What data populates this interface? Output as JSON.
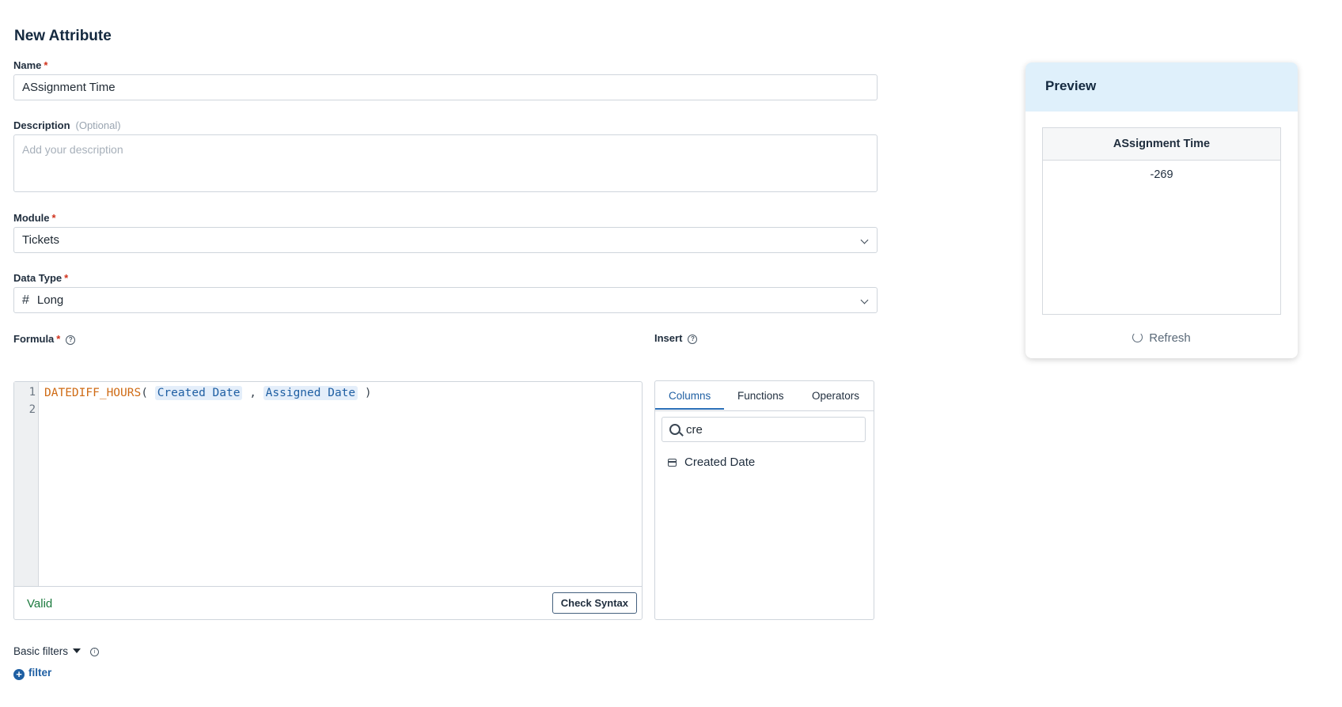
{
  "page": {
    "title": "New Attribute"
  },
  "name": {
    "label": "Name",
    "required": "*",
    "value": "ASsignment Time"
  },
  "description": {
    "label": "Description",
    "optional": "(Optional)",
    "placeholder": "Add your description"
  },
  "module": {
    "label": "Module",
    "required": "*",
    "value": "Tickets"
  },
  "data_type": {
    "label": "Data Type",
    "required": "*",
    "icon": "hash-icon",
    "icon_glyph": "#",
    "value": "Long"
  },
  "formula": {
    "label": "Formula",
    "required": "*",
    "line_numbers": [
      "1",
      "2"
    ],
    "function": "DATEDIFF_HOURS",
    "open_paren": "(",
    "arg1": "Created Date",
    "comma": ",",
    "arg2": "Assigned Date",
    "close_paren": ")",
    "status": "Valid",
    "check_button": "Check Syntax"
  },
  "insert": {
    "label": "Insert",
    "tabs": [
      "Columns",
      "Functions",
      "Operators"
    ],
    "active_tab": "Columns",
    "search_value": "cre",
    "results": [
      "Created Date"
    ]
  },
  "filters": {
    "label": "Basic filters",
    "add_label": "filter"
  },
  "preview": {
    "title": "Preview",
    "column_header": "ASsignment Time",
    "value": "-269",
    "refresh_label": "Refresh"
  },
  "colors": {
    "accent": "#1f5fa3",
    "valid": "#1c7a3e",
    "function": "#cf6b15",
    "preview_header": "#dff0fb",
    "required": "#d0321c"
  }
}
